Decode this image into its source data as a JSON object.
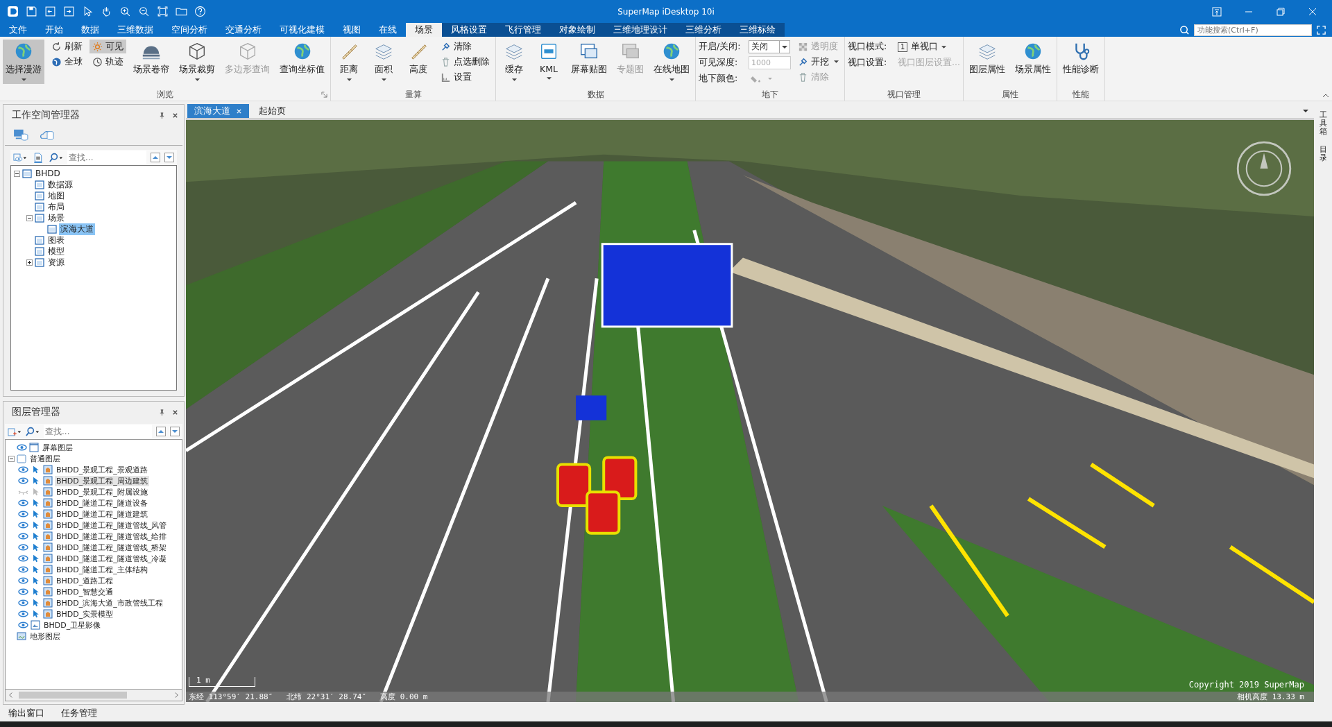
{
  "window": {
    "title": "SuperMap iDesktop 10i"
  },
  "menu_tabs": [
    {
      "label": "文件",
      "selected": false,
      "contextual": false
    },
    {
      "label": "开始",
      "selected": false,
      "contextual": false
    },
    {
      "label": "数据",
      "selected": false,
      "contextual": false
    },
    {
      "label": "三维数据",
      "selected": false,
      "contextual": false
    },
    {
      "label": "空间分析",
      "selected": false,
      "contextual": false
    },
    {
      "label": "交通分析",
      "selected": false,
      "contextual": false
    },
    {
      "label": "可视化建模",
      "selected": false,
      "contextual": false
    },
    {
      "label": "视图",
      "selected": false,
      "contextual": false
    },
    {
      "label": "在线",
      "selected": false,
      "contextual": false
    },
    {
      "label": "场景",
      "selected": true,
      "contextual": false
    },
    {
      "label": "风格设置",
      "selected": false,
      "contextual": true
    },
    {
      "label": "飞行管理",
      "selected": false,
      "contextual": true
    },
    {
      "label": "对象绘制",
      "selected": false,
      "contextual": true
    },
    {
      "label": "三维地理设计",
      "selected": false,
      "contextual": true
    },
    {
      "label": "三维分析",
      "selected": false,
      "contextual": true
    },
    {
      "label": "三维标绘",
      "selected": false,
      "contextual": true
    }
  ],
  "search": {
    "placeholder": "功能搜索(Ctrl+F)"
  },
  "ribbon": {
    "groups": [
      {
        "title": "浏览",
        "launcher": true,
        "columns": [
          {
            "kind": "large",
            "label": "选择漫游",
            "selected": true,
            "disabled": false,
            "dropdown": true
          },
          {
            "kind": "stack",
            "items": [
              {
                "kind": "button",
                "label": "刷新",
                "selected": false,
                "disabled": false,
                "dropdown": false
              },
              {
                "kind": "button",
                "label": "全球",
                "selected": false,
                "disabled": false,
                "dropdown": false
              }
            ]
          },
          {
            "kind": "stack",
            "items": [
              {
                "kind": "button",
                "label": "可见",
                "selected": true,
                "disabled": false,
                "dropdown": false
              },
              {
                "kind": "button",
                "label": "轨迹",
                "selected": false,
                "disabled": false,
                "dropdown": false
              }
            ]
          },
          {
            "kind": "large",
            "label": "场景卷帘",
            "selected": false,
            "disabled": false,
            "dropdown": false
          },
          {
            "kind": "large",
            "label": "场景裁剪",
            "selected": false,
            "disabled": false,
            "dropdown": true
          },
          {
            "kind": "large",
            "label": "多边形查询",
            "selected": false,
            "disabled": true,
            "dropdown": false
          },
          {
            "kind": "large",
            "label": "查询坐标值",
            "selected": false,
            "disabled": false,
            "dropdown": false
          }
        ]
      },
      {
        "title": "量算",
        "columns": [
          {
            "kind": "large",
            "label": "距离",
            "selected": false,
            "disabled": false,
            "dropdown": true
          },
          {
            "kind": "large",
            "label": "面积",
            "selected": false,
            "disabled": false,
            "dropdown": true
          },
          {
            "kind": "large",
            "label": "高度",
            "selected": false,
            "disabled": false,
            "dropdown": false
          },
          {
            "kind": "stack",
            "items": [
              {
                "kind": "button",
                "label": "清除",
                "selected": false,
                "disabled": false,
                "dropdown": false
              },
              {
                "kind": "button",
                "label": "点选删除",
                "selected": false,
                "disabled": false,
                "dropdown": false
              },
              {
                "kind": "button",
                "label": "设置",
                "selected": false,
                "disabled": false,
                "dropdown": false
              }
            ]
          }
        ]
      },
      {
        "title": "数据",
        "columns": [
          {
            "kind": "large",
            "label": "缓存",
            "selected": false,
            "disabled": false,
            "dropdown": true
          },
          {
            "kind": "large",
            "label": "KML",
            "selected": false,
            "disabled": false,
            "dropdown": true
          },
          {
            "kind": "large",
            "label": "屏幕贴图",
            "selected": false,
            "disabled": false,
            "dropdown": false
          },
          {
            "kind": "large",
            "label": "专题图",
            "selected": false,
            "disabled": true,
            "dropdown": false
          },
          {
            "kind": "large",
            "label": "在线地图",
            "selected": false,
            "disabled": false,
            "dropdown": true
          }
        ]
      },
      {
        "title": "地下",
        "columns": [
          {
            "kind": "stack",
            "items": [
              {
                "kind": "select",
                "label": "开启/关闭:",
                "value": "关闭",
                "disabled": false
              },
              {
                "kind": "input",
                "label": "可见深度:",
                "value": "1000",
                "disabled": true
              },
              {
                "kind": "color",
                "label": "地下颜色:",
                "disabled": true
              }
            ]
          },
          {
            "kind": "stack",
            "items": [
              {
                "kind": "button",
                "label": "透明度",
                "selected": false,
                "disabled": true,
                "dropdown": false
              },
              {
                "kind": "button",
                "label": "开挖",
                "selected": false,
                "disabled": false,
                "dropdown": true
              },
              {
                "kind": "button",
                "label": "清除",
                "selected": false,
                "disabled": true,
                "dropdown": false
              }
            ]
          }
        ]
      },
      {
        "title": "视口管理",
        "columns": [
          {
            "kind": "stack",
            "items": [
              {
                "kind": "menu",
                "label": "视口模式:",
                "badge": "1",
                "value": "单视口",
                "disabled": false
              },
              {
                "kind": "text",
                "label": "视口设置:",
                "value": "视口图层设置...",
                "disabled": true
              }
            ]
          }
        ]
      },
      {
        "title": "属性",
        "columns": [
          {
            "kind": "large",
            "label": "图层属性",
            "selected": false,
            "disabled": false,
            "dropdown": false
          },
          {
            "kind": "large",
            "label": "场景属性",
            "selected": false,
            "disabled": false,
            "dropdown": false
          }
        ]
      },
      {
        "title": "性能",
        "columns": [
          {
            "kind": "large",
            "label": "性能诊断",
            "selected": false,
            "disabled": false,
            "dropdown": false
          }
        ]
      }
    ]
  },
  "workspace_manager": {
    "title": "工作空间管理器",
    "search_placeholder": "查找...",
    "tree": [
      {
        "label": "BHDD",
        "selected": false,
        "expanded": true,
        "children": [
          {
            "label": "数据源",
            "selected": false
          },
          {
            "label": "地图",
            "selected": false
          },
          {
            "label": "布局",
            "selected": false
          },
          {
            "label": "场景",
            "selected": false,
            "expanded": true,
            "children": [
              {
                "label": "滨海大道",
                "selected": true
              }
            ]
          },
          {
            "label": "图表",
            "selected": false
          },
          {
            "label": "模型",
            "selected": false
          },
          {
            "label": "资源",
            "selected": false,
            "expanded": false
          }
        ]
      }
    ]
  },
  "layer_manager": {
    "title": "图层管理器",
    "search_placeholder": "查找...",
    "tree": [
      {
        "kind": "screen",
        "label": "屏幕图层",
        "visible": true,
        "selected": false
      },
      {
        "kind": "group",
        "label": "普通图层",
        "expanded": true,
        "selected": false,
        "children": [
          {
            "kind": "vector",
            "label": "BHDD_景观工程_景观道路",
            "visible": true,
            "selectable": true,
            "selected": false
          },
          {
            "kind": "vector",
            "label": "BHDD_景观工程_周边建筑",
            "visible": true,
            "selectable": true,
            "selected": true
          },
          {
            "kind": "vector",
            "label": "BHDD_景观工程_附属设施",
            "visible": false,
            "selectable": false,
            "selected": false
          },
          {
            "kind": "vector",
            "label": "BHDD_隧道工程_隧道设备",
            "visible": true,
            "selectable": true,
            "selected": false
          },
          {
            "kind": "vector",
            "label": "BHDD_隧道工程_隧道建筑",
            "visible": true,
            "selectable": true,
            "selected": false
          },
          {
            "kind": "vector",
            "label": "BHDD_隧道工程_隧道管线_风管",
            "visible": true,
            "selectable": true,
            "selected": false
          },
          {
            "kind": "vector",
            "label": "BHDD_隧道工程_隧道管线_给排",
            "visible": true,
            "selectable": true,
            "selected": false
          },
          {
            "kind": "vector",
            "label": "BHDD_隧道工程_隧道管线_桥架",
            "visible": true,
            "selectable": true,
            "selected": false
          },
          {
            "kind": "vector",
            "label": "BHDD_隧道工程_隧道管线_冷凝",
            "visible": true,
            "selectable": true,
            "selected": false
          },
          {
            "kind": "vector",
            "label": "BHDD_隧道工程_主体结构",
            "visible": true,
            "selectable": true,
            "selected": false
          },
          {
            "kind": "vector",
            "label": "BHDD_道路工程",
            "visible": true,
            "selectable": true,
            "selected": false
          },
          {
            "kind": "vector",
            "label": "BHDD_智慧交通",
            "visible": true,
            "selectable": true,
            "selected": false
          },
          {
            "kind": "vector",
            "label": "BHDD_滨海大道_市政管线工程",
            "visible": true,
            "selectable": true,
            "selected": false
          },
          {
            "kind": "vector",
            "label": "BHDD_实景模型",
            "visible": true,
            "selectable": true,
            "selected": false
          },
          {
            "kind": "image",
            "label": "BHDD_卫星影像",
            "visible": true,
            "selected": false
          }
        ]
      },
      {
        "kind": "terrain",
        "label": "地形图层",
        "selected": false
      }
    ]
  },
  "doc_tabs": [
    {
      "label": "滨海大道",
      "selected": true,
      "closable": true
    },
    {
      "label": "起始页",
      "selected": false,
      "closable": false
    }
  ],
  "scene": {
    "scale": "1 m",
    "coordinates": [
      "东经 113°59′ 21.88″",
      "北纬 22°31′ 28.74″",
      "高度 0.00 m"
    ],
    "copyright": "Copyright 2019 SuperMap",
    "camera_height": "相机高度 13.33 m"
  },
  "side_dock_tabs": [
    "工具箱",
    "目录"
  ],
  "bottom_tabs": [
    "输出窗口",
    "任务管理"
  ]
}
